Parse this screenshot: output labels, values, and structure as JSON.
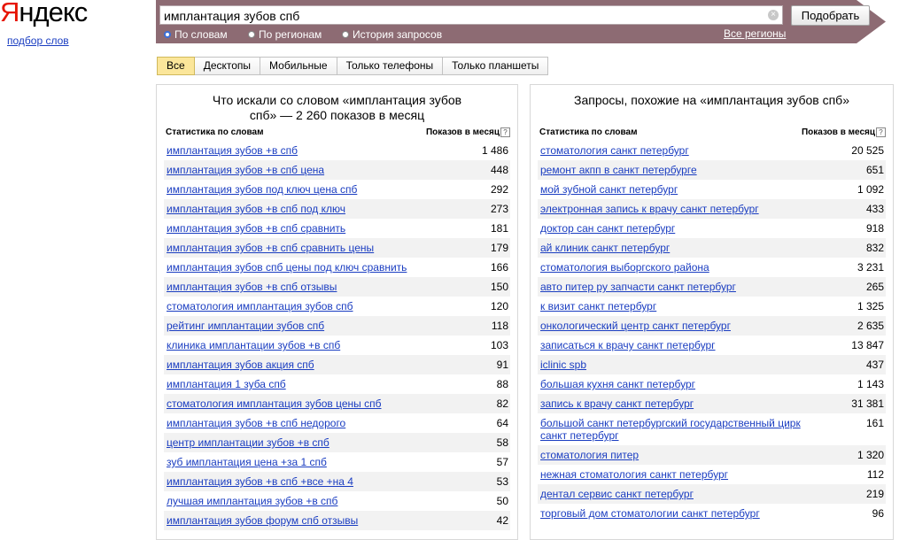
{
  "brand": {
    "logo_first": "Я",
    "logo_rest": "ндекс",
    "service_link": "подбор слов"
  },
  "search": {
    "query": "имплантация зубов спб",
    "submit_label": "Подобрать",
    "clear_icon": "×"
  },
  "modes": [
    {
      "label": "По словам",
      "checked": true
    },
    {
      "label": "По регионам",
      "checked": false
    },
    {
      "label": "История запросов",
      "checked": false
    }
  ],
  "regions_link": "Все регионы",
  "tabs": [
    {
      "label": "Все",
      "active": true
    },
    {
      "label": "Десктопы",
      "active": false
    },
    {
      "label": "Мобильные",
      "active": false
    },
    {
      "label": "Только телефоны",
      "active": false
    },
    {
      "label": "Только планшеты",
      "active": false
    }
  ],
  "left_panel": {
    "title": "Что искали со словом «имплантация зубов спб» — 2 260 показов в месяц",
    "col_phrase": "Статистика по словам",
    "col_count": "Показов в месяц",
    "rows": [
      {
        "phrase": "имплантация зубов +в спб",
        "count": "1 486"
      },
      {
        "phrase": "имплантация зубов +в спб цена",
        "count": "448"
      },
      {
        "phrase": "имплантация зубов под ключ цена спб",
        "count": "292"
      },
      {
        "phrase": "имплантация зубов +в спб под ключ",
        "count": "273"
      },
      {
        "phrase": "имплантация зубов +в спб сравнить",
        "count": "181"
      },
      {
        "phrase": "имплантация зубов +в спб сравнить цены",
        "count": "179"
      },
      {
        "phrase": "имплантация зубов спб цены под ключ сравнить",
        "count": "166"
      },
      {
        "phrase": "имплантация зубов +в спб отзывы",
        "count": "150"
      },
      {
        "phrase": "стоматология имплантация зубов спб",
        "count": "120"
      },
      {
        "phrase": "рейтинг имплантации зубов спб",
        "count": "118"
      },
      {
        "phrase": "клиника имплантации зубов +в спб",
        "count": "103"
      },
      {
        "phrase": "имплантация зубов акция спб",
        "count": "91"
      },
      {
        "phrase": "имплантация 1 зуба спб",
        "count": "88"
      },
      {
        "phrase": "стоматология имплантация зубов цены спб",
        "count": "82"
      },
      {
        "phrase": "имплантация зубов +в спб недорого",
        "count": "64"
      },
      {
        "phrase": "центр имплантации зубов +в спб",
        "count": "58"
      },
      {
        "phrase": "зуб имплантация цена +за 1 спб",
        "count": "57"
      },
      {
        "phrase": "имплантация зубов +в спб +все +на 4",
        "count": "53"
      },
      {
        "phrase": "лучшая имплантация зубов +в спб",
        "count": "50"
      },
      {
        "phrase": "имплантация зубов форум спб отзывы",
        "count": "42"
      }
    ]
  },
  "right_panel": {
    "title": "Запросы, похожие на «имплантация зубов спб»",
    "col_phrase": "Статистика по словам",
    "col_count": "Показов в месяц",
    "rows": [
      {
        "phrase": "стоматология санкт петербург",
        "count": "20 525"
      },
      {
        "phrase": "ремонт акпп в санкт петербурге",
        "count": "651"
      },
      {
        "phrase": "мой зубной санкт петербург",
        "count": "1 092"
      },
      {
        "phrase": "электронная запись к врачу санкт петербург",
        "count": "433"
      },
      {
        "phrase": "доктор сан санкт петербург",
        "count": "918"
      },
      {
        "phrase": "ай клиник санкт петербург",
        "count": "832"
      },
      {
        "phrase": "стоматология выборгского района",
        "count": "3 231"
      },
      {
        "phrase": "авто питер ру запчасти санкт петербург",
        "count": "265"
      },
      {
        "phrase": "к визит санкт петербург",
        "count": "1 325"
      },
      {
        "phrase": "онкологический центр санкт петербург",
        "count": "2 635"
      },
      {
        "phrase": "записаться к врачу санкт петербург",
        "count": "13 847"
      },
      {
        "phrase": "iclinic spb",
        "count": "437"
      },
      {
        "phrase": "большая кухня санкт петербург",
        "count": "1 143"
      },
      {
        "phrase": "запись к врачу санкт петербург",
        "count": "31 381"
      },
      {
        "phrase": "большой санкт петербургский государственный цирк санкт петербург",
        "count": "161"
      },
      {
        "phrase": "стоматология питер",
        "count": "1 320"
      },
      {
        "phrase": "нежная стоматология санкт петербург",
        "count": "112"
      },
      {
        "phrase": "дентал сервис санкт петербург",
        "count": "219"
      },
      {
        "phrase": "торговый дом стоматологии санкт петербург",
        "count": "96"
      }
    ]
  }
}
